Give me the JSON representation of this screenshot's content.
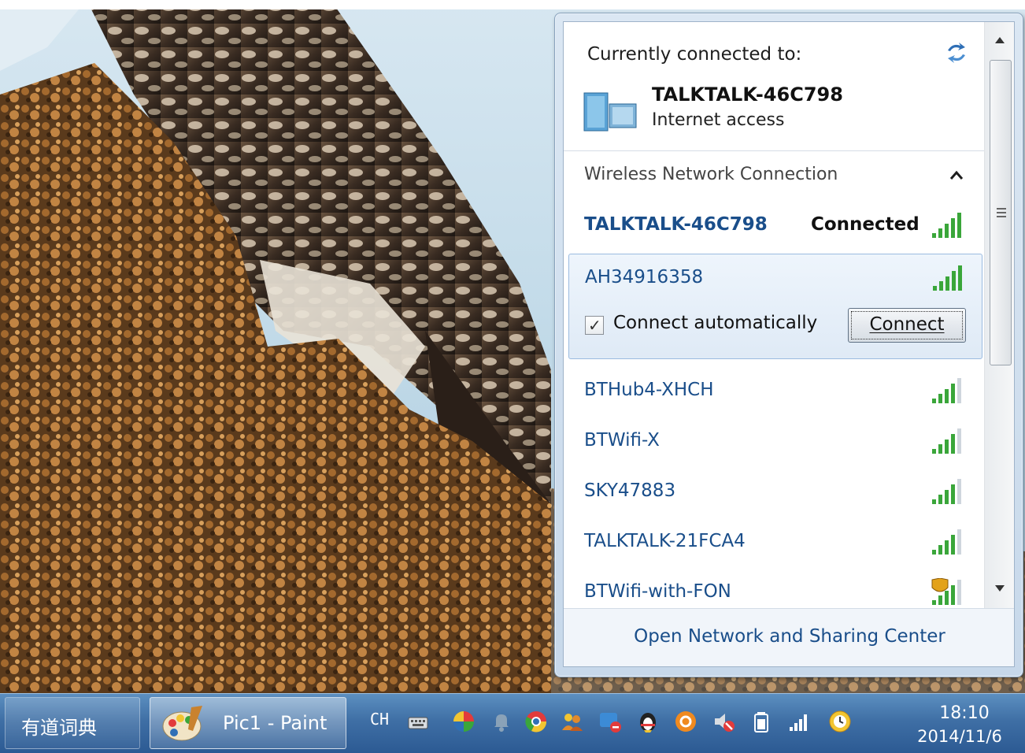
{
  "network_flyout": {
    "current_heading": "Currently connected to:",
    "current_network": {
      "name": "TALKTALK-46C798",
      "status": "Internet access"
    },
    "section_label": "Wireless Network Connection",
    "networks": [
      {
        "name": "TALKTALK-46C798",
        "status": "Connected"
      },
      {
        "name": "AH34916358",
        "connect_auto_label": "Connect automatically",
        "connect_auto_checked": true,
        "connect_button": "Connect"
      },
      {
        "name": "BTHub4-XHCH"
      },
      {
        "name": "BTWifi-X"
      },
      {
        "name": "SKY47883"
      },
      {
        "name": "TALKTALK-21FCA4"
      },
      {
        "name": "BTWifi-with-FON",
        "security_shield": true
      }
    ],
    "footer_link": "Open Network and Sharing Center"
  },
  "taskbar": {
    "dictionary_app": "有道词典",
    "paint_window": "Pic1 - Paint",
    "language": "CH",
    "tray_icons": [
      "keyboard-icon",
      "colorful-pinwheel-icon",
      "bell-icon",
      "chrome-icon",
      "people-icon",
      "chat-blocked-icon",
      "penguin-icon",
      "orange-circle-icon",
      "speaker-muted-icon",
      "battery-icon",
      "signal-bars-icon",
      "clock-app-icon"
    ],
    "clock": {
      "time": "18:10",
      "date": "2014/11/6"
    }
  },
  "colors": {
    "link_blue": "#1a4e8a",
    "taskbar_blue": "#3f6fa5",
    "selection_border": "#9bbbe0"
  }
}
